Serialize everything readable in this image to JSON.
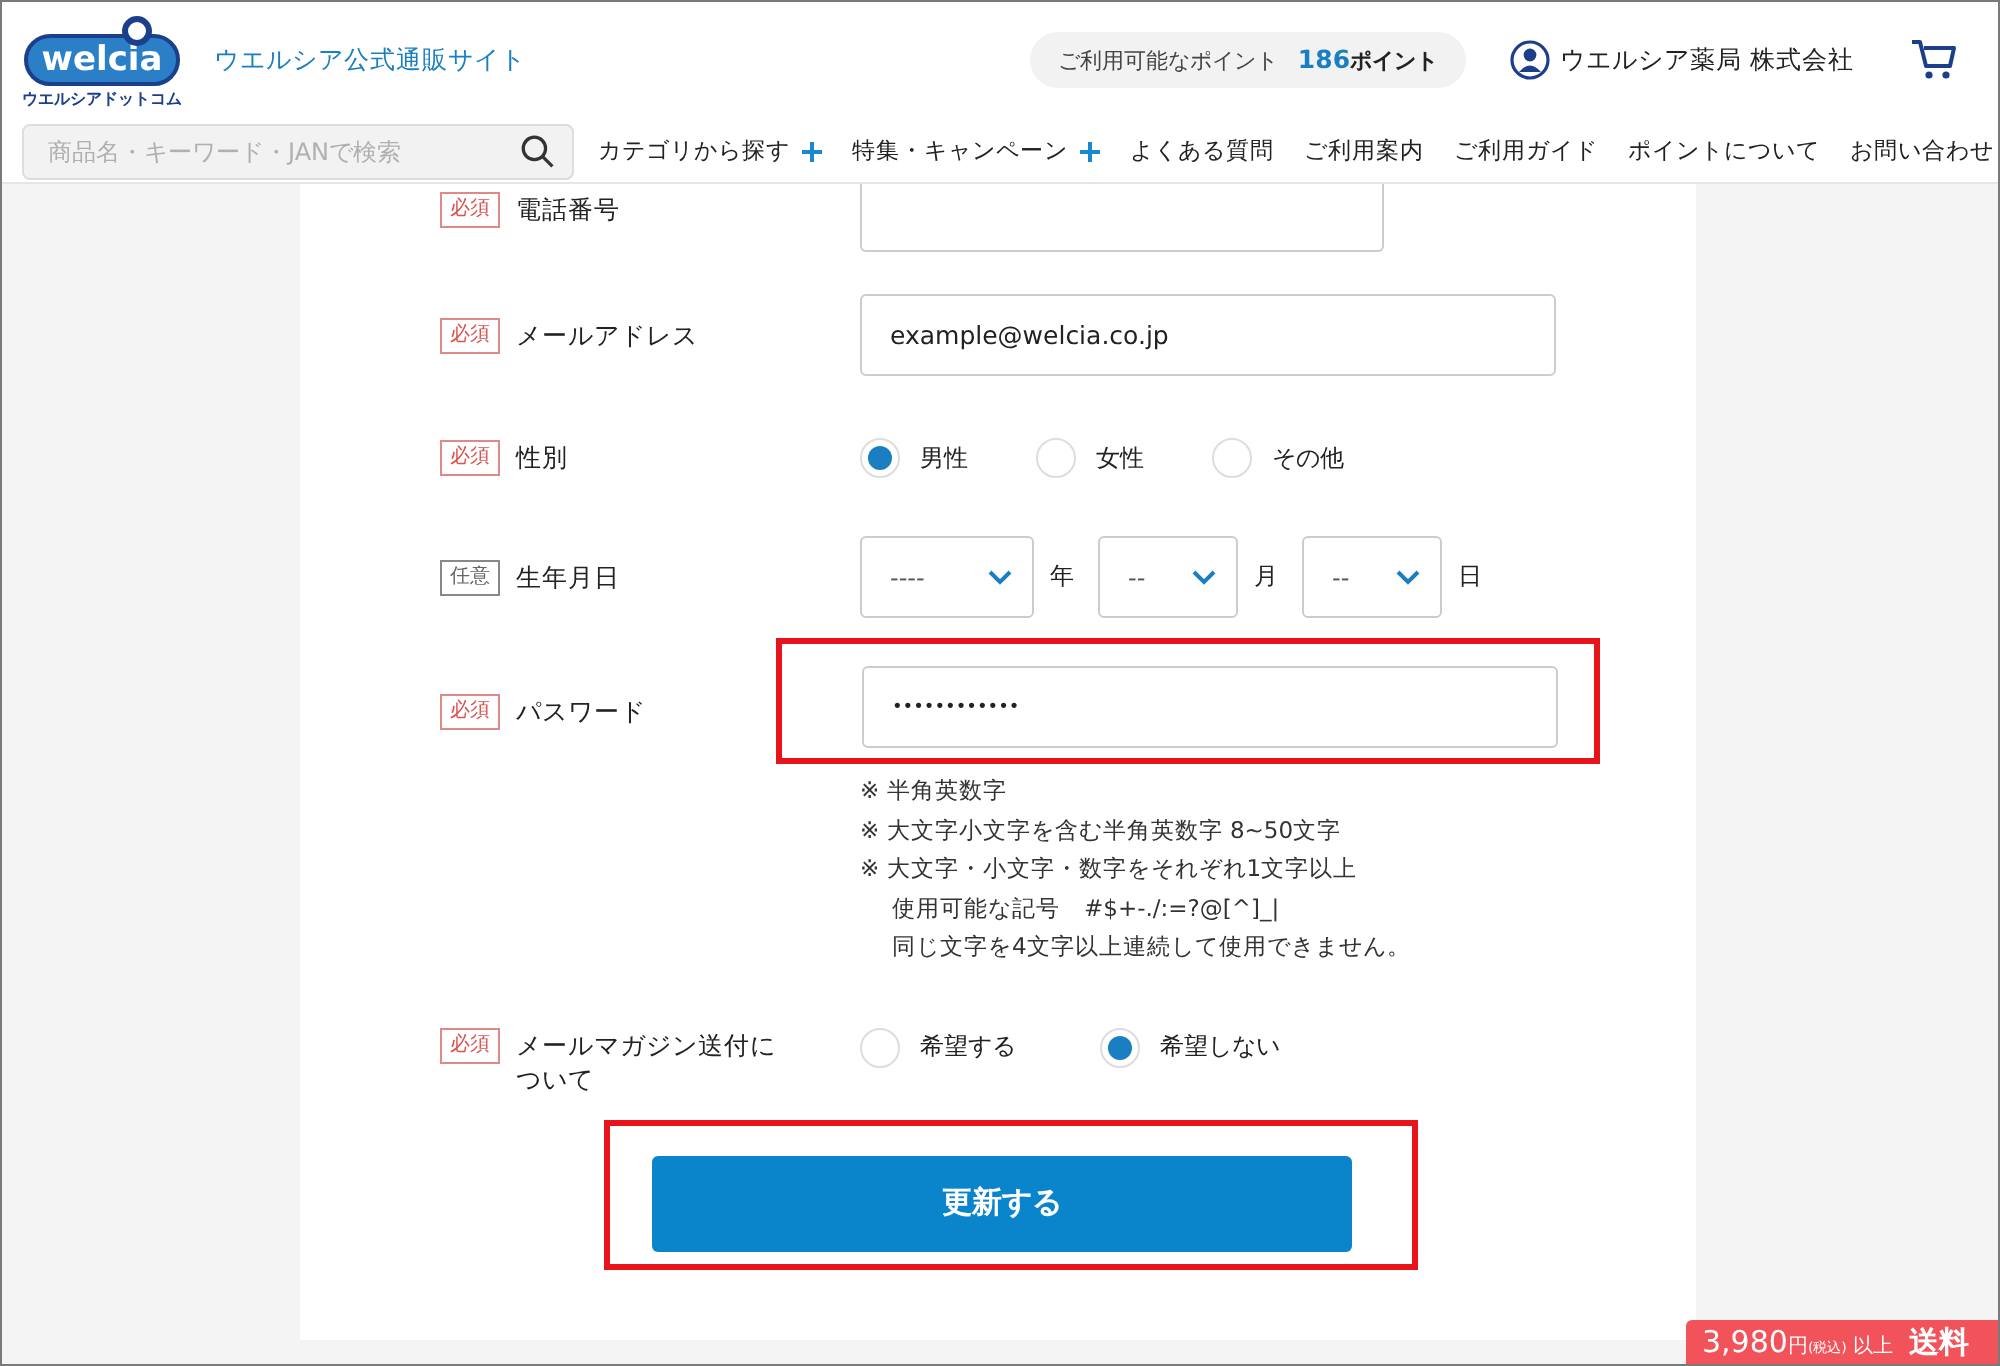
{
  "header": {
    "logo": {
      "wordmark": "welcia",
      "sub": "ウエルシアドットコム"
    },
    "site_name": "ウエルシア公式通販サイト",
    "points": {
      "label": "ご利用可能なポイント",
      "value": "186",
      "unit": "ポイント"
    },
    "user_name": "ウエルシア薬局 株式会社",
    "search": {
      "placeholder": "商品名・キーワード・JANで検索"
    },
    "nav": [
      {
        "label": "カテゴリから探す",
        "expandable": true
      },
      {
        "label": "特集・キャンペーン",
        "expandable": true
      },
      {
        "label": "よくある質問",
        "expandable": false
      },
      {
        "label": "ご利用案内",
        "expandable": false
      },
      {
        "label": "ご利用ガイド",
        "expandable": false
      },
      {
        "label": "ポイントについて",
        "expandable": false
      },
      {
        "label": "お問い合わせ",
        "expandable": false
      }
    ]
  },
  "form": {
    "rows": [
      {
        "kind": "text",
        "badge": {
          "label": "必須",
          "required": true
        },
        "label": "電話番号",
        "value": "",
        "highlighted": false
      },
      {
        "kind": "text",
        "badge": {
          "label": "必須",
          "required": true
        },
        "label": "メールアドレス",
        "value": "example@welcia.co.jp",
        "highlighted": false
      },
      {
        "kind": "radio",
        "badge": {
          "label": "必須",
          "required": true
        },
        "label": "性別",
        "options": [
          {
            "label": "男性",
            "selected": true
          },
          {
            "label": "女性",
            "selected": false
          },
          {
            "label": "その他",
            "selected": false
          }
        ]
      },
      {
        "kind": "date",
        "badge": {
          "label": "任意",
          "required": false
        },
        "label": "生年月日",
        "selects": [
          {
            "value": "----",
            "unit": "年"
          },
          {
            "value": "--",
            "unit": "月"
          },
          {
            "value": "--",
            "unit": "日"
          }
        ]
      },
      {
        "kind": "password",
        "badge": {
          "label": "必須",
          "required": true
        },
        "label": "パスワード",
        "value": "••••••••••••",
        "highlighted": true,
        "notes": [
          "※ 半角英数字",
          "※ 大文字小文字を含む半角英数字 8~50文字",
          "※ 大文字・小文字・数字をそれぞれ1文字以上",
          "使用可能な記号　#$+-./:=?@[^]_|",
          "同じ文字を4文字以上連続して使用できません。"
        ]
      },
      {
        "kind": "radio",
        "badge": {
          "label": "必須",
          "required": true
        },
        "label": "メールマガジン送付について",
        "options": [
          {
            "label": "希望する",
            "selected": false
          },
          {
            "label": "希望しない",
            "selected": true
          }
        ]
      }
    ],
    "submit": {
      "label": "更新する",
      "highlighted": true
    }
  },
  "promo": {
    "price": "3,980",
    "unit": "円",
    "tax": "(税込)",
    "suffix": "以上",
    "label": "送料"
  }
}
